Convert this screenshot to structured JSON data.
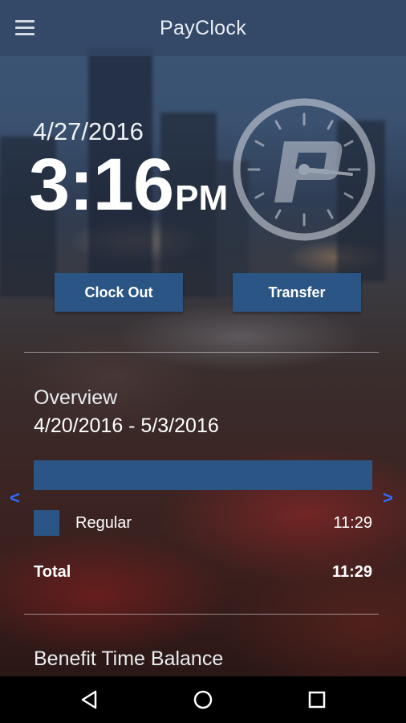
{
  "app": {
    "title": "PayClock"
  },
  "clock": {
    "date": "4/27/2016",
    "time": "3:16",
    "ampm": "PM"
  },
  "actions": {
    "clock_out": "Clock Out",
    "transfer": "Transfer"
  },
  "overview": {
    "title": "Overview",
    "range": "4/20/2016 - 5/3/2016",
    "prev_arrow": "<",
    "next_arrow": ">",
    "rows": [
      {
        "label": "Regular",
        "value": "11:29"
      }
    ],
    "total": {
      "label": "Total",
      "value": "11:29"
    }
  },
  "benefit": {
    "title": "Benefit Time Balance"
  },
  "colors": {
    "accent": "#2a5584",
    "arrow": "#2f6cff",
    "appbar": "#32466a"
  },
  "icons": {
    "menu": "hamburger-menu-icon",
    "back": "back-triangle-icon",
    "home": "home-circle-icon",
    "recents": "recents-square-icon"
  }
}
